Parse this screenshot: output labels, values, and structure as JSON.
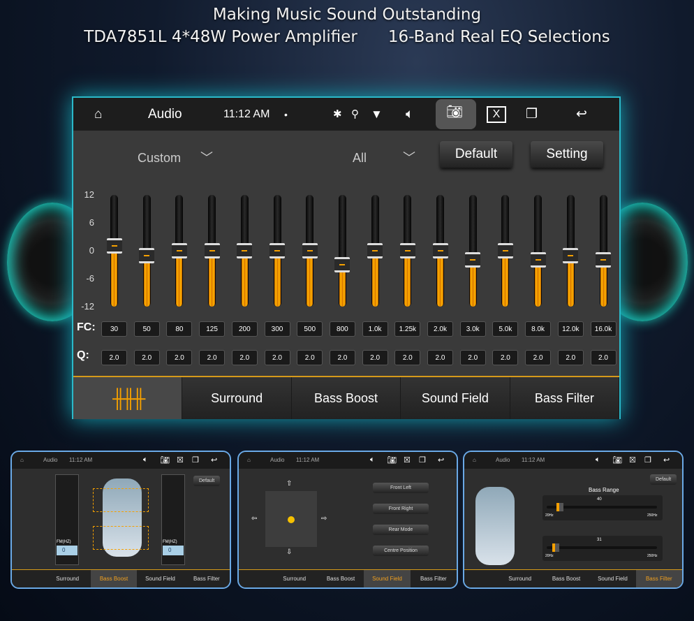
{
  "headline": {
    "line1": "Making Music Sound Outstanding",
    "line2a": "TDA7851L 4*48W Power Amplifier",
    "line2b": "16-Band Real EQ Selections"
  },
  "status": {
    "title": "Audio",
    "time": "11:12 AM",
    "dot": "•"
  },
  "icons": {
    "home": "home-icon",
    "bluetooth": "bluetooth-icon",
    "location": "location-icon",
    "wifi": "wifi-icon",
    "volume": "volume-icon",
    "screenshot": "camera-icon",
    "close": "close-window-icon",
    "windows": "recent-apps-icon",
    "back": "back-icon"
  },
  "eq": {
    "preset": "Custom",
    "channel": "All",
    "default_label": "Default",
    "setting_label": "Setting",
    "y_ticks": [
      "12",
      "6",
      "0",
      "-6",
      "-12"
    ],
    "range": [
      -12,
      12
    ],
    "fc_label": "FC:",
    "q_label": "Q:",
    "bands": [
      {
        "fc": "30",
        "q": "2.0",
        "gain": 1
      },
      {
        "fc": "50",
        "q": "2.0",
        "gain": -1
      },
      {
        "fc": "80",
        "q": "2.0",
        "gain": 0
      },
      {
        "fc": "125",
        "q": "2.0",
        "gain": 0
      },
      {
        "fc": "200",
        "q": "2.0",
        "gain": 0
      },
      {
        "fc": "300",
        "q": "2.0",
        "gain": 0
      },
      {
        "fc": "500",
        "q": "2.0",
        "gain": 0
      },
      {
        "fc": "800",
        "q": "2.0",
        "gain": -3
      },
      {
        "fc": "1.0k",
        "q": "2.0",
        "gain": 0
      },
      {
        "fc": "1.25k",
        "q": "2.0",
        "gain": 0
      },
      {
        "fc": "2.0k",
        "q": "2.0",
        "gain": 0
      },
      {
        "fc": "3.0k",
        "q": "2.0",
        "gain": -2
      },
      {
        "fc": "5.0k",
        "q": "2.0",
        "gain": 0
      },
      {
        "fc": "8.0k",
        "q": "2.0",
        "gain": -2
      },
      {
        "fc": "12.0k",
        "q": "2.0",
        "gain": -1
      },
      {
        "fc": "16.0k",
        "q": "2.0",
        "gain": -2
      }
    ]
  },
  "tabs": [
    "Surround",
    "Bass Boost",
    "Sound Field",
    "Bass Filter"
  ],
  "accent": "#f5a000",
  "thumbs": [
    {
      "active": "Bass Boost",
      "default_label": "Default",
      "fader_label": "FM(HZ)",
      "fader_value": "0"
    },
    {
      "active": "Sound Field",
      "buttons": [
        "Front Left",
        "Front Right",
        "Rear Mode",
        "Centre Position"
      ]
    },
    {
      "active": "Bass Filter",
      "default_label": "Default",
      "title": "Bass Range",
      "sliders": [
        {
          "value": "40",
          "min": "20Hz",
          "max": "250Hz",
          "fraction": 0.09
        },
        {
          "value": "31",
          "min": "20Hz",
          "max": "250Hz",
          "fraction": 0.05
        }
      ]
    }
  ]
}
